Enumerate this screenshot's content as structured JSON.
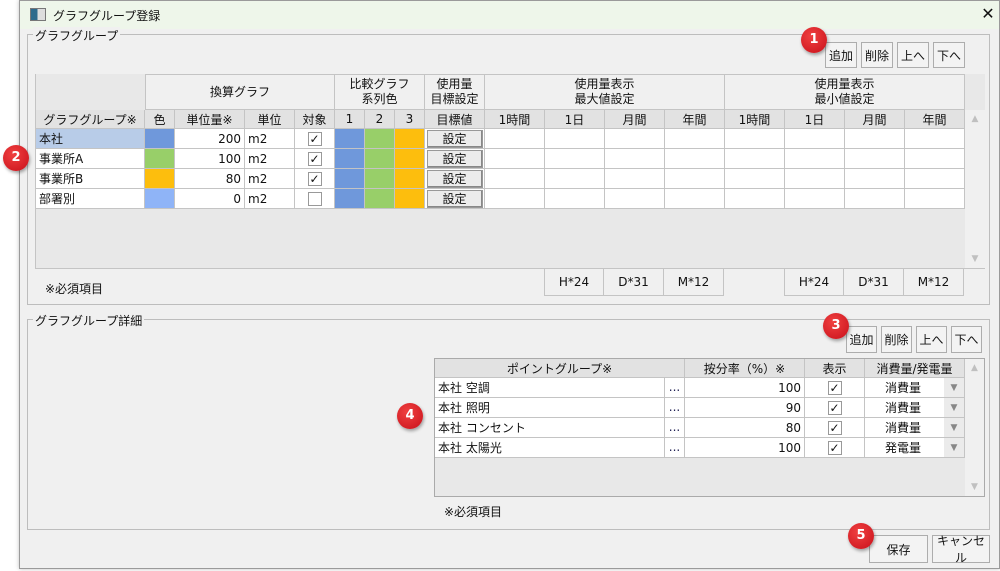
{
  "window": {
    "title": "グラフグループ登録",
    "close": "✕"
  },
  "group1": {
    "label": "グラフグループ",
    "buttons": {
      "add": "追加",
      "delete": "削除",
      "up": "上へ",
      "down": "下へ"
    },
    "super_headers": {
      "conv": "換算グラフ",
      "compare": "比較グラフ\n系列色",
      "target": "使用量\n目標設定",
      "max": "使用量表示\n最大値設定",
      "min": "使用量表示\n最小値設定"
    },
    "columns": [
      "グラフグループ※",
      "色",
      "単位量※",
      "単位",
      "対象",
      "1",
      "2",
      "3",
      "目標値",
      "1時間",
      "1日",
      "月間",
      "年間",
      "1時間",
      "1日",
      "月間",
      "年間"
    ],
    "rows": [
      {
        "name": "本社",
        "color": "#6f98db",
        "amount": "200",
        "unit": "m2",
        "target": true,
        "series": [
          "#6f98db",
          "#98cf69",
          "#fdbe0d"
        ],
        "set": "設定",
        "selected": true
      },
      {
        "name": "事業所A",
        "color": "#98cf69",
        "amount": "100",
        "unit": "m2",
        "target": true,
        "series": [
          "#6f98db",
          "#98cf69",
          "#fdbe0d"
        ],
        "set": "設定"
      },
      {
        "name": "事業所B",
        "color": "#fdbe0d",
        "amount": "80",
        "unit": "m2",
        "target": true,
        "series": [
          "#6f98db",
          "#98cf69",
          "#fdbe0d"
        ],
        "set": "設定"
      },
      {
        "name": "部署別",
        "color": "#8fb4f7",
        "amount": "0",
        "unit": "m2",
        "target": false,
        "series": [
          "#6f98db",
          "#98cf69",
          "#fdbe0d"
        ],
        "set": "設定"
      }
    ],
    "footer_max": [
      "H*24",
      "D*31",
      "M*12"
    ],
    "footer_min": [
      "H*24",
      "D*31",
      "M*12"
    ],
    "required_note": "※必須項目"
  },
  "group2": {
    "label": "グラフグループ詳細",
    "buttons": {
      "add": "追加",
      "delete": "削除",
      "up": "上へ",
      "down": "下へ"
    },
    "columns": [
      "ポイントグループ※",
      "按分率（%）※",
      "表示",
      "消費量/発電量"
    ],
    "rows": [
      {
        "name": "本社 空調",
        "ellipsis": "...",
        "ratio": "100",
        "show": true,
        "type": "消費量"
      },
      {
        "name": "本社 照明",
        "ellipsis": "...",
        "ratio": "90",
        "show": true,
        "type": "消費量"
      },
      {
        "name": "本社 コンセント",
        "ellipsis": "...",
        "ratio": "80",
        "show": true,
        "type": "消費量"
      },
      {
        "name": "本社 太陽光",
        "ellipsis": "...",
        "ratio": "100",
        "show": true,
        "type": "発電量"
      }
    ],
    "required_note": "※必須項目"
  },
  "footer": {
    "save": "保存",
    "cancel": "キャンセル"
  },
  "badges": [
    "1",
    "2",
    "3",
    "4",
    "5"
  ],
  "colors": {
    "selected_row": "#b8cce8",
    "badge": "#d9161f"
  }
}
